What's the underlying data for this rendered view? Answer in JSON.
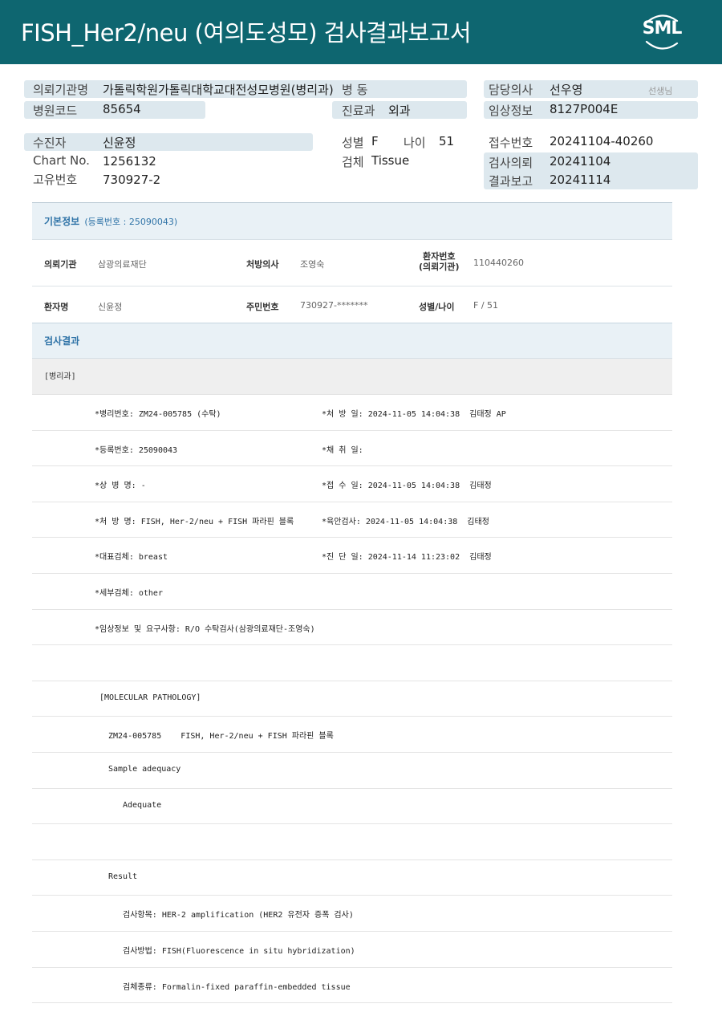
{
  "header": {
    "title": "FISH_Her2/neu  (여의도성모) 검사결과보고서",
    "logo": "SML"
  },
  "info": {
    "requesting_institution": {
      "label": "의뢰기관명",
      "value": "가톨릭학원가톨릭대학교대전성모병원(병리과)"
    },
    "ward": {
      "label": "병 동",
      "value": ""
    },
    "attending": {
      "label": "담당의사",
      "value": "선우영",
      "suffix": "선생님"
    },
    "hospital_code": {
      "label": "병원코드",
      "value": "85654"
    },
    "department": {
      "label": "진료과",
      "value": "외과"
    },
    "clinical_info": {
      "label": "임상정보",
      "value": "8127P004E"
    },
    "patient": {
      "label": "수진자",
      "value": "신윤정"
    },
    "sex": {
      "label": "성별",
      "value": "F"
    },
    "age": {
      "label": "나이",
      "value": "51"
    },
    "receipt_no": {
      "label": "접수번호",
      "value": "20241104-40260"
    },
    "chart_no": {
      "label": "Chart No.",
      "value": "1256132"
    },
    "specimen": {
      "label": "검체",
      "value": "Tissue"
    },
    "request_date": {
      "label": "검사의뢰",
      "value": "20241104"
    },
    "unique_no": {
      "label": "고유번호",
      "value": "730927-2"
    },
    "report_date": {
      "label": "결과보고",
      "value": "20241114"
    }
  },
  "basic": {
    "title": "기본정보",
    "reg": "(등록번호 : 25090043)",
    "institution_label": "의뢰기관",
    "institution_value": "삼광의료재단",
    "doctor_label": "처방의사",
    "doctor_value": "조영숙",
    "patient_no_label_1": "환자번호",
    "patient_no_label_2": "(의뢰기관)",
    "patient_no_value": "110440260",
    "name_label": "환자명",
    "name_value": "신윤정",
    "rrn_label": "주민번호",
    "rrn_value": "730927-*******",
    "sexage_label": "성별/나이",
    "sexage_value": "F / 51"
  },
  "results": {
    "title": "검사결과",
    "subhead": "[병리과]",
    "rows": [
      {
        "left": "*병리번호: ZM24-005785 (수탁)",
        "right": "*처 방 일: 2024-11-05 14:04:38  김태정 AP"
      },
      {
        "left": "*등록번호: 25090043",
        "right": "*채 취 일:"
      },
      {
        "left": "*상 병 명: -",
        "right": "*접 수 일: 2024-11-05 14:04:38  김태정"
      },
      {
        "left": "*처 방 명: FISH, Her-2/neu + FISH 파라핀 블록",
        "right": "*육안검사: 2024-11-05 14:04:38  김태정"
      },
      {
        "left": "*대표검체: breast",
        "right": "*진 단 일: 2024-11-14 11:23:02  김태정"
      },
      {
        "left": "*세부검체: other",
        "right": ""
      },
      {
        "left": "*임상정보 및 요구사항: R/O 수탁검사(삼광의료재단-조영숙)",
        "right": ""
      },
      {
        "left": "",
        "right": ""
      },
      {
        "left": "[MOLECULAR PATHOLOGY]",
        "right": ""
      },
      {
        "left": "ZM24-005785    FISH, Her-2/neu + FISH 파라핀 블록",
        "right": ""
      },
      {
        "left": "Sample adequacy",
        "right": ""
      },
      {
        "left": "Adequate",
        "right": ""
      },
      {
        "left": "",
        "right": ""
      },
      {
        "left": "Result",
        "right": ""
      },
      {
        "left": "검사항목: HER-2 amplification (HER2 유전자 증폭 검사)",
        "right": ""
      },
      {
        "left": "검사방법: FISH(Fluorescence in situ hybridization)",
        "right": ""
      },
      {
        "left": "검체종류: Formalin-fixed paraffin-embedded tissue",
        "right": ""
      }
    ]
  }
}
